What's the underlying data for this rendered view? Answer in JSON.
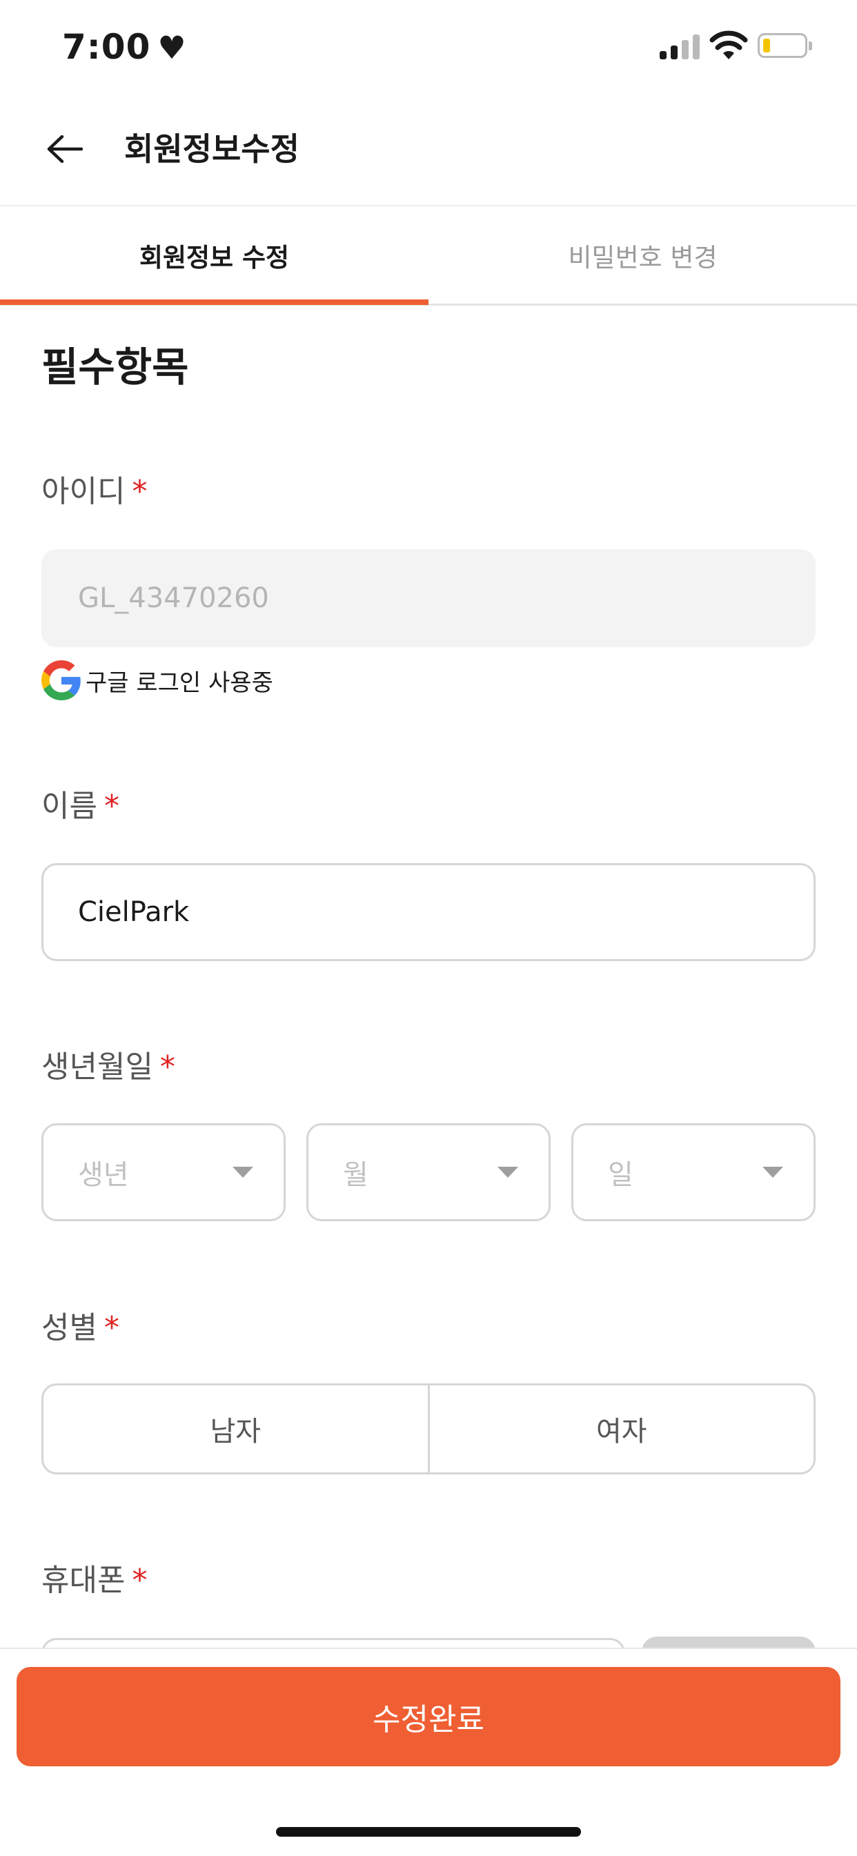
{
  "status_bar": {
    "time": "7:00",
    "heart": "♥"
  },
  "header": {
    "title": "회원정보수정"
  },
  "tabs": [
    {
      "label": "회원정보 수정",
      "active": true
    },
    {
      "label": "비밀번호 변경",
      "active": false
    }
  ],
  "form": {
    "section_title": "필수항목",
    "required_mark": "*",
    "id": {
      "label": "아이디",
      "value": "GL_43470260",
      "login_note": "구글 로그인 사용중"
    },
    "name": {
      "label": "이름",
      "value": "CielPark"
    },
    "birth": {
      "label": "생년월일",
      "year_placeholder": "생년",
      "month_placeholder": "월",
      "day_placeholder": "일"
    },
    "gender": {
      "label": "성별",
      "male": "남자",
      "female": "여자"
    },
    "phone": {
      "label": "휴대폰"
    }
  },
  "submit_label": "수정완료",
  "colors": {
    "accent": "#ef5f33",
    "required": "#e02020",
    "battery": "#f5c400"
  }
}
